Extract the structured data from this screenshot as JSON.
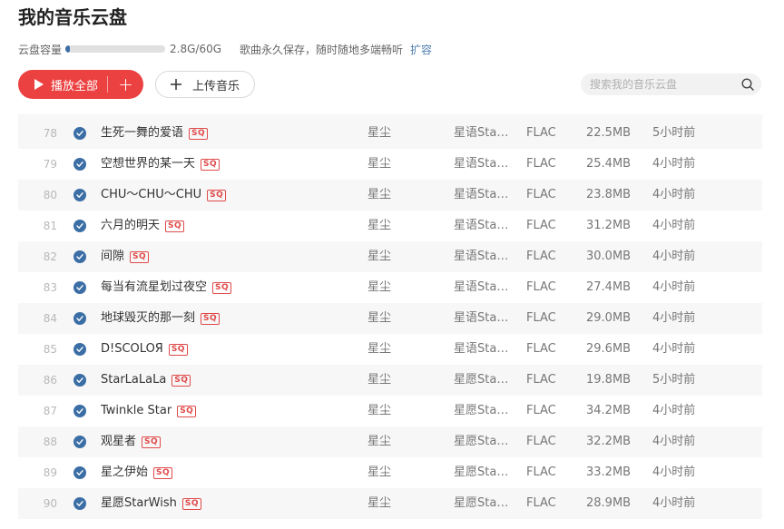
{
  "page": {
    "title": "我的音乐云盘"
  },
  "capacity": {
    "label": "云盘容量",
    "used_text": "2.8G/60G",
    "used_fraction": 0.047,
    "description": "歌曲永久保存，随时随地多端畅听",
    "expand_link": "扩容"
  },
  "toolbar": {
    "play_all": "播放全部",
    "add_icon": "+",
    "upload": "上传音乐"
  },
  "search": {
    "placeholder": "搜索我的音乐云盘"
  },
  "colors": {
    "accent": "#ec4141",
    "check": "#3b6ea5",
    "link": "#507daf"
  },
  "songs": [
    {
      "index": "78",
      "name": "生死一舞的爱语",
      "badge": "SQ",
      "artist": "星尘",
      "album": "星语StarDust",
      "format": "FLAC",
      "size": "22.5MB",
      "time": "5小时前"
    },
    {
      "index": "79",
      "name": "空想世界的某一天",
      "badge": "SQ",
      "artist": "星尘",
      "album": "星语StarDust",
      "format": "FLAC",
      "size": "25.4MB",
      "time": "4小时前"
    },
    {
      "index": "80",
      "name": "CHU～CHU～CHU",
      "badge": "SQ",
      "artist": "星尘",
      "album": "星语StarDust",
      "format": "FLAC",
      "size": "23.8MB",
      "time": "4小时前"
    },
    {
      "index": "81",
      "name": "六月的明天",
      "badge": "SQ",
      "artist": "星尘",
      "album": "星语StarDust",
      "format": "FLAC",
      "size": "31.2MB",
      "time": "4小时前"
    },
    {
      "index": "82",
      "name": "间隙",
      "badge": "SQ",
      "artist": "星尘",
      "album": "星语StarDust",
      "format": "FLAC",
      "size": "30.0MB",
      "time": "4小时前"
    },
    {
      "index": "83",
      "name": "每当有流星划过夜空",
      "badge": "SQ",
      "artist": "星尘",
      "album": "星语StarDust",
      "format": "FLAC",
      "size": "27.4MB",
      "time": "4小时前"
    },
    {
      "index": "84",
      "name": "地球毁灭的那一刻",
      "badge": "SQ",
      "artist": "星尘",
      "album": "星语StarDust",
      "format": "FLAC",
      "size": "29.0MB",
      "time": "4小时前"
    },
    {
      "index": "85",
      "name": "D!SCOLOЯ",
      "badge": "SQ",
      "artist": "星尘",
      "album": "星语StarDust",
      "format": "FLAC",
      "size": "29.6MB",
      "time": "4小时前"
    },
    {
      "index": "86",
      "name": "StarLaLaLa",
      "badge": "SQ",
      "artist": "星尘",
      "album": "星愿StarWish",
      "format": "FLAC",
      "size": "19.8MB",
      "time": "5小时前"
    },
    {
      "index": "87",
      "name": "Twinkle Star",
      "badge": "SQ",
      "artist": "星尘",
      "album": "星愿StarWish",
      "format": "FLAC",
      "size": "34.2MB",
      "time": "4小时前"
    },
    {
      "index": "88",
      "name": "观星者",
      "badge": "SQ",
      "artist": "星尘",
      "album": "星愿StarWish",
      "format": "FLAC",
      "size": "32.2MB",
      "time": "4小时前"
    },
    {
      "index": "89",
      "name": "星之伊始",
      "badge": "SQ",
      "artist": "星尘",
      "album": "星愿StarWish",
      "format": "FLAC",
      "size": "33.2MB",
      "time": "4小时前"
    },
    {
      "index": "90",
      "name": "星愿StarWish",
      "badge": "SQ",
      "artist": "星尘",
      "album": "星愿StarWish",
      "format": "FLAC",
      "size": "28.9MB",
      "time": "4小时前"
    }
  ]
}
